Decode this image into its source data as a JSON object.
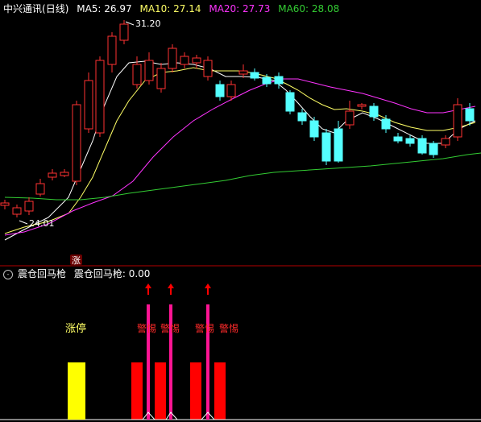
{
  "main_panel": {
    "stock_name": "中兴通讯",
    "period": "(日线)",
    "ma_labels": [
      {
        "text": "MA5: 26.97",
        "color": "#ffffff"
      },
      {
        "text": "MA10: 27.14",
        "color": "#ffff66"
      },
      {
        "text": "MA20: 27.73",
        "color": "#ff33ff"
      },
      {
        "text": "MA60: 28.08",
        "color": "#33cc33"
      }
    ],
    "high_marker": "31.20",
    "low_marker": "24.01",
    "zhang_badge": "涨"
  },
  "indicator_panel": {
    "name": "震仓回马枪",
    "value_label": "震仓回马枪: 0.00",
    "zhangting_label": "涨停",
    "warning_label": "警惕",
    "warning_count": 4
  },
  "colors": {
    "bg": "#000000",
    "up": "#ff3232",
    "down": "#54ffff",
    "ma5": "#ffffff",
    "ma10": "#ffff66",
    "ma20": "#ff33ff",
    "ma60": "#33cc33",
    "divider": "#b40000",
    "yellow_bar": "#ffff00",
    "red_bar": "#ff0000",
    "pink_bar": "#ff1493"
  }
}
